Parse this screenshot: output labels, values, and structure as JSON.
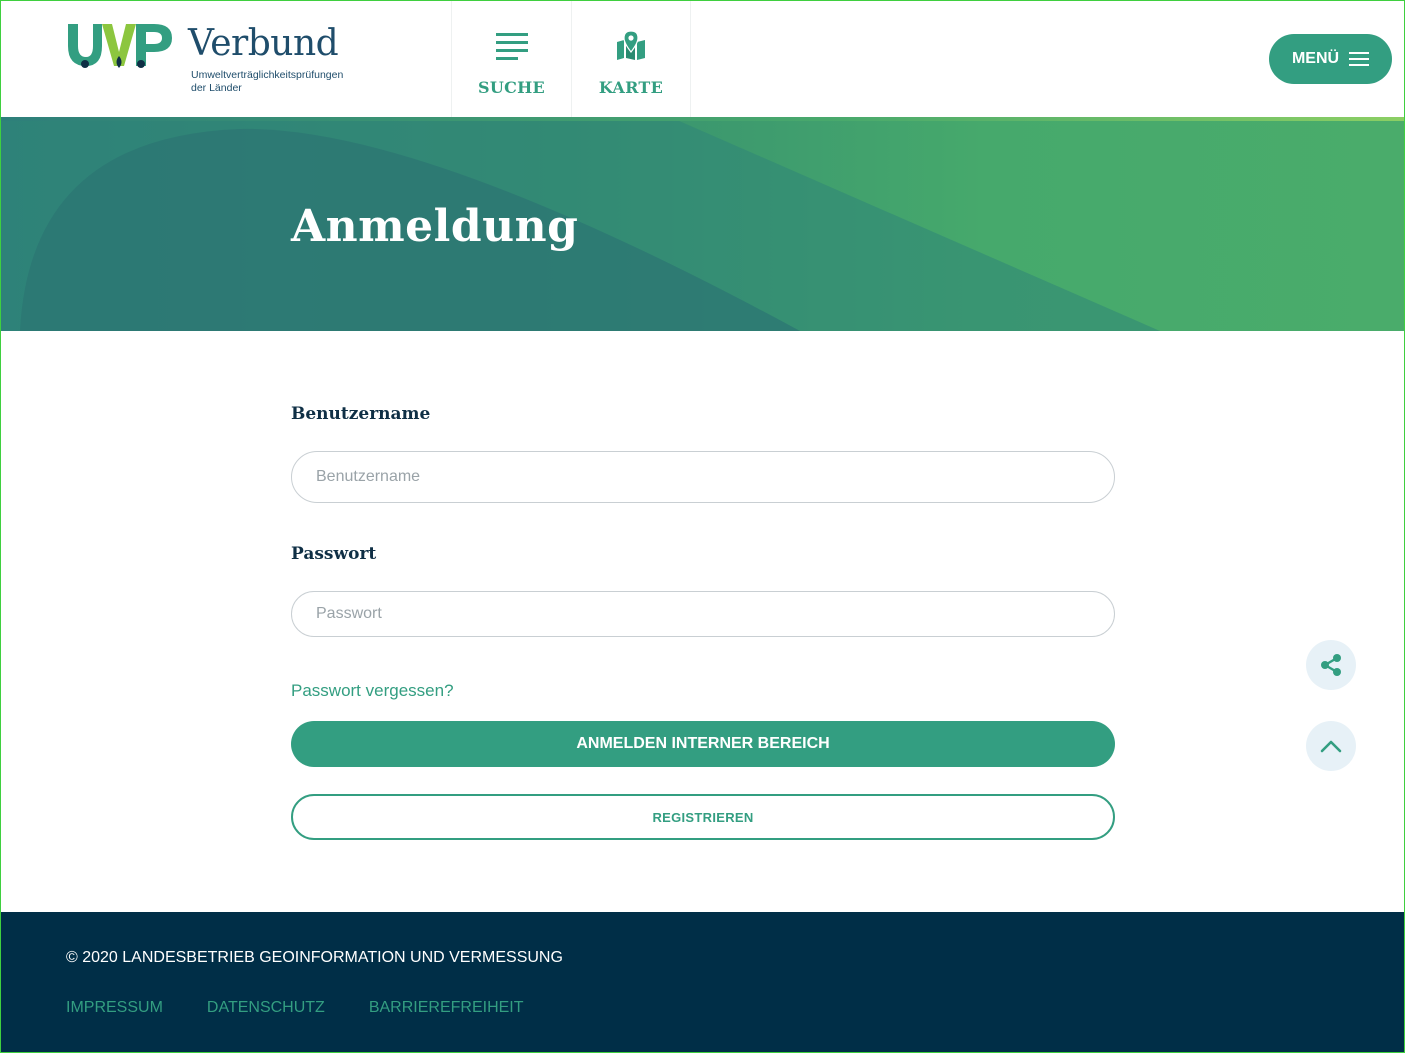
{
  "header": {
    "logo_wordmark": "Verbund",
    "logo_subtitle_line1": "Umweltverträglichkeitsprüfungen",
    "logo_subtitle_line2": "der Länder",
    "logo_mark_text": "UVP",
    "nav": [
      {
        "label": "SUCHE",
        "icon": "list-icon"
      },
      {
        "label": "KARTE",
        "icon": "map-pin-icon"
      }
    ],
    "menu_label": "MENÜ"
  },
  "hero": {
    "title": "Anmeldung"
  },
  "form": {
    "username_label": "Benutzername",
    "username_placeholder": "Benutzername",
    "username_value": "",
    "password_label": "Passwort",
    "password_placeholder": "Passwort",
    "password_value": "",
    "forgot_link": "Passwort vergessen?",
    "login_button": "ANMELDEN INTERNER BEREICH",
    "register_button": "REGISTRIEREN"
  },
  "floating": {
    "share_icon": "share-icon",
    "scroll_top_icon": "chevron-up-icon"
  },
  "footer": {
    "copyright": "© 2020 LANDESBETRIEB GEOINFORMATION UND VERMESSUNG",
    "links": [
      "IMPRESSUM",
      "DATENSCHUTZ",
      "BARRIEREFREIHEIT"
    ]
  },
  "colors": {
    "accent": "#339e81",
    "footer_bg": "#002e47",
    "heading_dark": "#0f2f45",
    "logo_blue": "#1f4d6b"
  }
}
